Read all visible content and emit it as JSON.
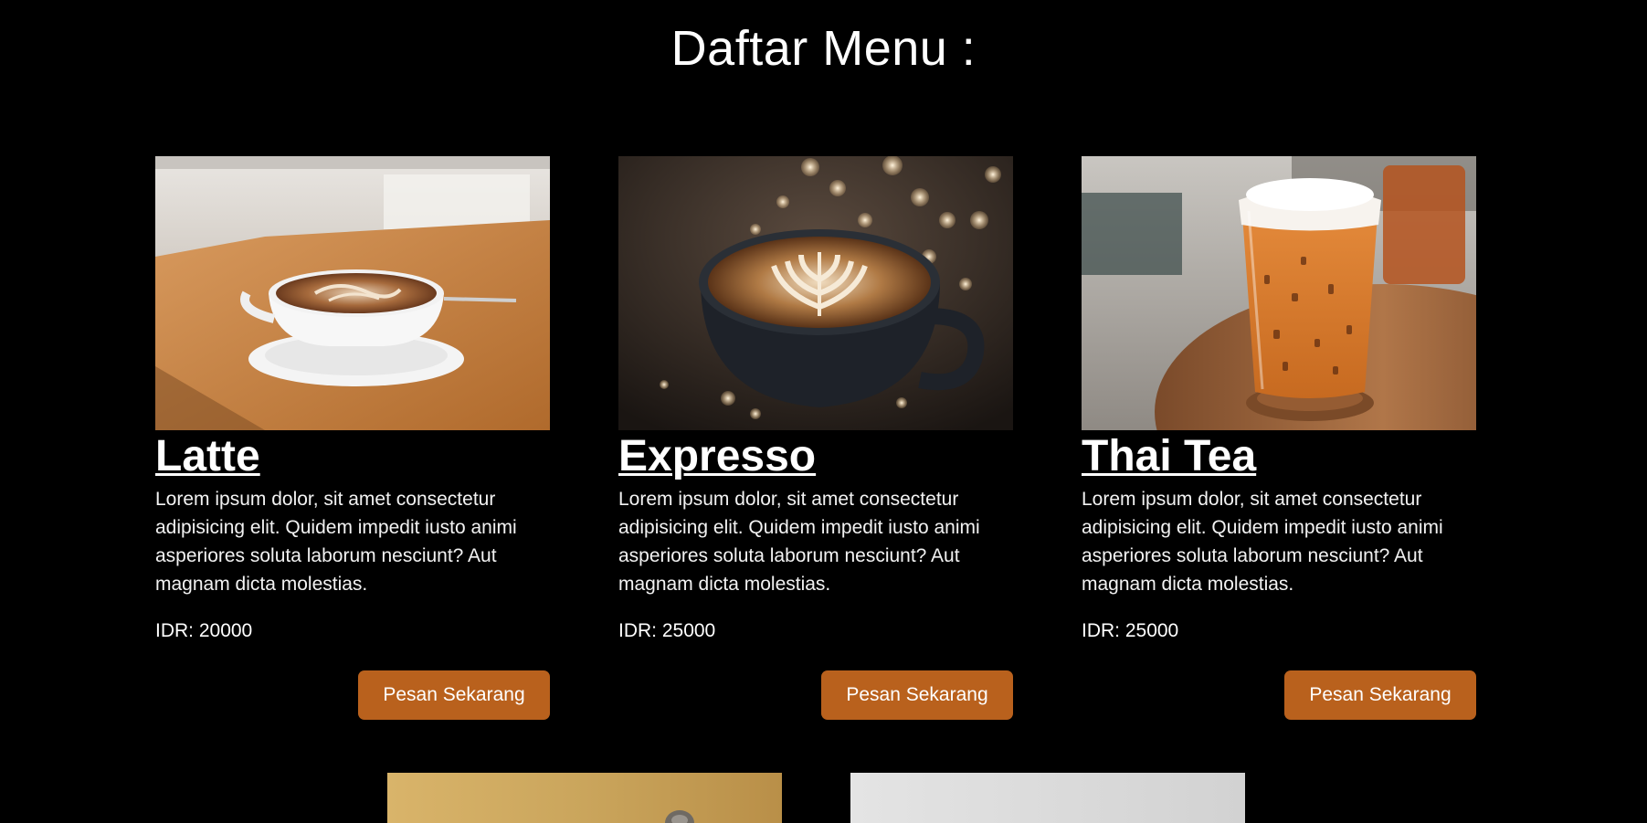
{
  "page": {
    "title": "Daftar Menu :"
  },
  "menu": {
    "items": [
      {
        "name": "Latte",
        "description": "Lorem ipsum dolor, sit amet consectetur adipisicing elit. Quidem impedit iusto animi asperiores soluta laborum nesciunt? Aut magnam dicta molestias.",
        "price": "IDR: 20000",
        "button_label": "Pesan Sekarang",
        "image_icon": "latte-cup-photo"
      },
      {
        "name": "Expresso",
        "description": "Lorem ipsum dolor, sit amet consectetur adipisicing elit. Quidem impedit iusto animi asperiores soluta laborum nesciunt? Aut magnam dicta molestias.",
        "price": "IDR: 25000",
        "button_label": "Pesan Sekarang",
        "image_icon": "espresso-cup-photo"
      },
      {
        "name": "Thai Tea",
        "description": "Lorem ipsum dolor, sit amet consectetur adipisicing elit. Quidem impedit iusto animi asperiores soluta laborum nesciunt? Aut magnam dicta molestias.",
        "price": "IDR: 25000",
        "button_label": "Pesan Sekarang",
        "image_icon": "thai-tea-glass-photo"
      }
    ]
  },
  "colors": {
    "background": "#000000",
    "text": "#ffffff",
    "button": "#b9611d"
  }
}
